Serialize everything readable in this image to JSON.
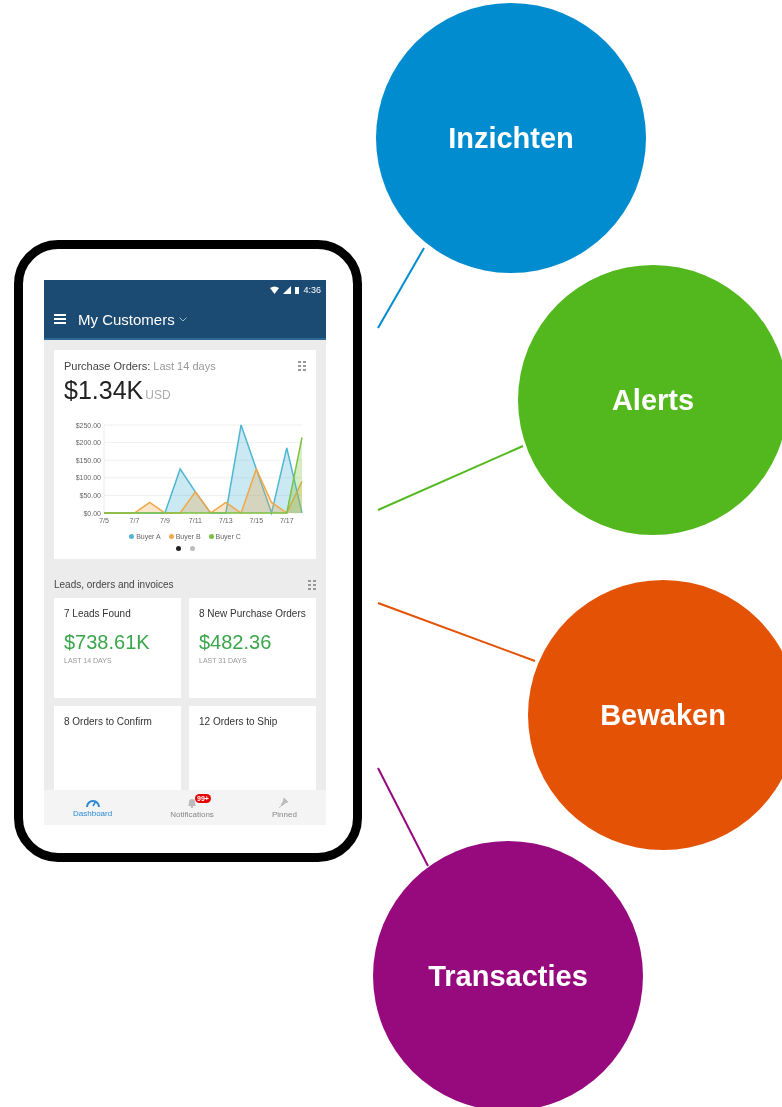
{
  "phone": {
    "status_bar": {
      "time": "4:36"
    },
    "app_bar": {
      "title": "My Customers"
    },
    "purchase_card": {
      "title": "Purchase Orders:",
      "subtitle": "Last 14 days",
      "amount": "$1.34K",
      "currency": "USD",
      "chart_data": {
        "type": "area",
        "categories": [
          "7/5",
          null,
          "7/7",
          null,
          "7/9",
          null,
          "7/11",
          null,
          "7/13",
          null,
          "7/15",
          null,
          "7/17",
          null
        ],
        "series": [
          {
            "name": "Buyer A",
            "color": "#4fb6d3",
            "values": [
              0,
              0,
              0,
              0,
              0,
              125,
              60,
              0,
              0,
              250,
              125,
              0,
              185,
              0
            ]
          },
          {
            "name": "Buyer B",
            "color": "#f0a848",
            "values": [
              0,
              0,
              0,
              30,
              0,
              0,
              60,
              0,
              30,
              0,
              125,
              30,
              0,
              90
            ]
          },
          {
            "name": "Buyer C",
            "color": "#7cc242",
            "values": [
              0,
              0,
              0,
              0,
              0,
              0,
              0,
              0,
              0,
              0,
              0,
              0,
              0,
              215
            ]
          }
        ],
        "ylim": [
          0,
          250
        ],
        "grid": true,
        "yticks": [
          {
            "value": 0,
            "label": "$0.00"
          },
          {
            "value": 50,
            "label": "$50.00"
          },
          {
            "value": 100,
            "label": "$100.00"
          },
          {
            "value": 150,
            "label": "$150.00"
          },
          {
            "value": 200,
            "label": "$200.00"
          },
          {
            "value": 250,
            "label": "$250.00"
          }
        ]
      },
      "pages": [
        {
          "selected": true
        },
        {
          "selected": false
        }
      ]
    },
    "section": {
      "title": "Leads, orders and invoices"
    },
    "tiles": [
      {
        "title": "7 Leads Found",
        "value": "$738.61K",
        "period": "LAST 14 DAYS"
      },
      {
        "title": "8 New Purchase Orders",
        "value": "$482.36",
        "period": "LAST 31 DAYS"
      },
      {
        "title": "8 Orders to Confirm"
      },
      {
        "title": "12 Orders to Ship"
      }
    ],
    "nav": [
      {
        "kind": "dashboard",
        "label": "Dashboard",
        "selected": true
      },
      {
        "kind": "notifications",
        "label": "Notifications",
        "selected": false,
        "badge": "99+"
      },
      {
        "kind": "pinned",
        "label": "Pinned",
        "selected": false
      }
    ]
  },
  "bubbles": [
    {
      "label": "Inzichten",
      "color": "#008ccf"
    },
    {
      "label": "Alerts",
      "color": "#52b81e"
    },
    {
      "label": "Bewaken",
      "color": "#e35205"
    },
    {
      "label": "Transacties",
      "color": "#960a7e"
    }
  ]
}
